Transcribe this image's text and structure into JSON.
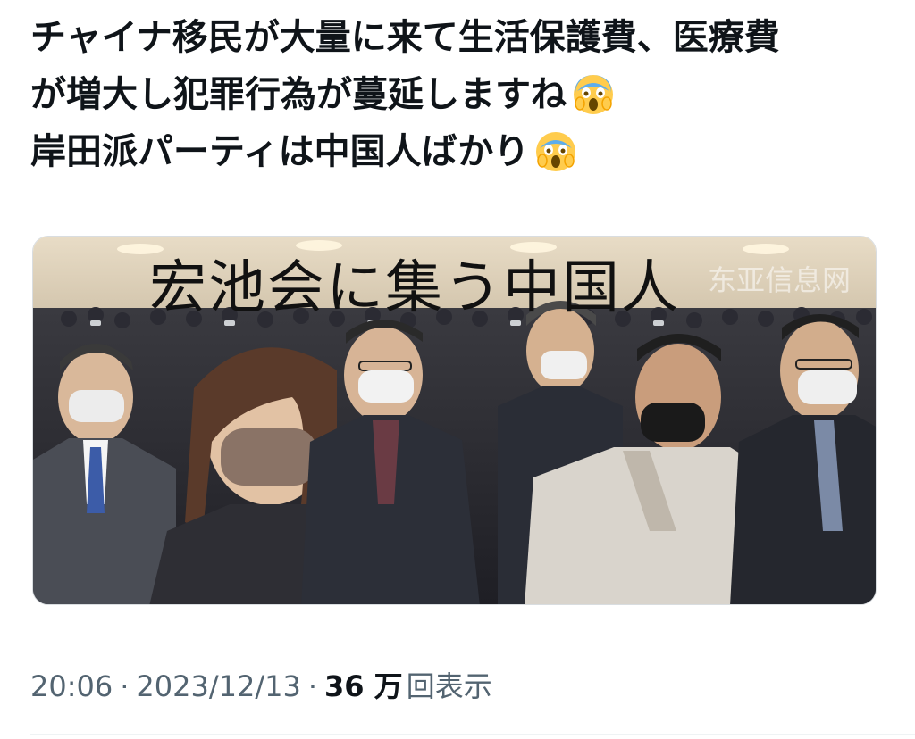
{
  "tweet": {
    "lines": [
      "チャイナ移民が大量に来て生活保護費、医療費",
      "が増大し犯罪行為が蔓延しますね",
      "岸田派パーティは中国人ばかり"
    ],
    "emoji": "face-screaming-in-fear-icon"
  },
  "media": {
    "caption": "宏池会に集う中国人",
    "watermark": "东亚信息网"
  },
  "meta": {
    "time": "20:06",
    "separator": "·",
    "date": "2023/12/13",
    "views_count": "36 万",
    "views_label": "回表示"
  },
  "colors": {
    "text": "#0f1419",
    "meta_text": "#536471",
    "divider": "#eff3f4",
    "emoji_yellow": "#ffcc4d",
    "emoji_blue": "#5dadec"
  }
}
